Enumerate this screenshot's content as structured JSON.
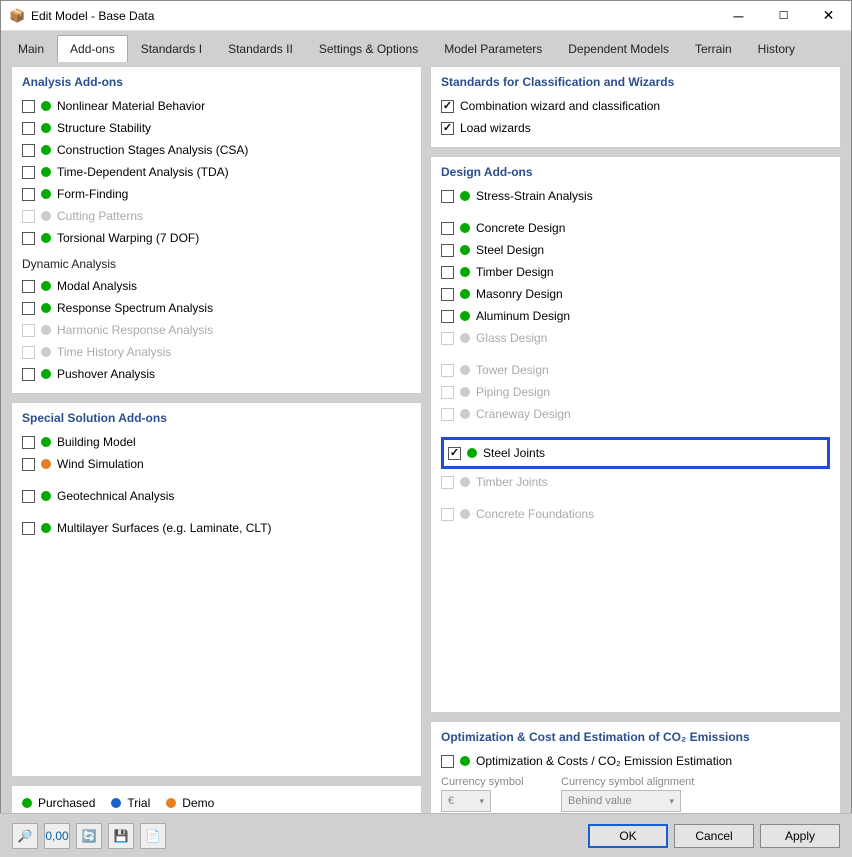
{
  "window": {
    "title": "Edit Model - Base Data",
    "icon": "📦"
  },
  "tabs": [
    "Main",
    "Add-ons",
    "Standards I",
    "Standards II",
    "Settings & Options",
    "Model Parameters",
    "Dependent Models",
    "Terrain",
    "History"
  ],
  "activeTab": 1,
  "left": {
    "analysis": {
      "title": "Analysis Add-ons",
      "items": [
        {
          "label": "Nonlinear Material Behavior",
          "dot": "green",
          "checked": false,
          "enabled": true
        },
        {
          "label": "Structure Stability",
          "dot": "green",
          "checked": false,
          "enabled": true
        },
        {
          "label": "Construction Stages Analysis (CSA)",
          "dot": "green",
          "checked": false,
          "enabled": true
        },
        {
          "label": "Time-Dependent Analysis (TDA)",
          "dot": "green",
          "checked": false,
          "enabled": true
        },
        {
          "label": "Form-Finding",
          "dot": "green",
          "checked": false,
          "enabled": true
        },
        {
          "label": "Cutting Patterns",
          "dot": "grey",
          "checked": false,
          "enabled": false
        },
        {
          "label": "Torsional Warping (7 DOF)",
          "dot": "green",
          "checked": false,
          "enabled": true
        }
      ],
      "dynTitle": "Dynamic Analysis",
      "dyn": [
        {
          "label": "Modal Analysis",
          "dot": "green",
          "checked": false,
          "enabled": true
        },
        {
          "label": "Response Spectrum Analysis",
          "dot": "green",
          "checked": false,
          "enabled": true
        },
        {
          "label": "Harmonic Response Analysis",
          "dot": "grey",
          "checked": false,
          "enabled": false
        },
        {
          "label": "Time History Analysis",
          "dot": "grey",
          "checked": false,
          "enabled": false
        },
        {
          "label": "Pushover Analysis",
          "dot": "green",
          "checked": false,
          "enabled": true
        }
      ]
    },
    "special": {
      "title": "Special Solution Add-ons",
      "items": [
        {
          "label": "Building Model",
          "dot": "green",
          "checked": false,
          "enabled": true
        },
        {
          "label": "Wind Simulation",
          "dot": "orange",
          "checked": false,
          "enabled": true
        },
        {
          "label": "Geotechnical Analysis",
          "dot": "green",
          "checked": false,
          "enabled": true
        },
        {
          "label": "Multilayer Surfaces (e.g. Laminate, CLT)",
          "dot": "green",
          "checked": false,
          "enabled": true
        }
      ]
    }
  },
  "right": {
    "standards": {
      "title": "Standards for Classification and Wizards",
      "items": [
        {
          "label": "Combination wizard and classification",
          "checked": true
        },
        {
          "label": "Load wizards",
          "checked": true
        }
      ]
    },
    "design": {
      "title": "Design Add-ons",
      "g1": [
        {
          "label": "Stress-Strain Analysis",
          "dot": "green",
          "checked": false,
          "enabled": true
        }
      ],
      "g2": [
        {
          "label": "Concrete Design",
          "dot": "green",
          "checked": false,
          "enabled": true
        },
        {
          "label": "Steel Design",
          "dot": "green",
          "checked": false,
          "enabled": true
        },
        {
          "label": "Timber Design",
          "dot": "green",
          "checked": false,
          "enabled": true
        },
        {
          "label": "Masonry Design",
          "dot": "green",
          "checked": false,
          "enabled": true
        },
        {
          "label": "Aluminum Design",
          "dot": "green",
          "checked": false,
          "enabled": true
        },
        {
          "label": "Glass Design",
          "dot": "grey",
          "checked": false,
          "enabled": false
        }
      ],
      "g3": [
        {
          "label": "Tower Design",
          "dot": "grey",
          "checked": false,
          "enabled": false
        },
        {
          "label": "Piping Design",
          "dot": "grey",
          "checked": false,
          "enabled": false
        },
        {
          "label": "Craneway Design",
          "dot": "grey",
          "checked": false,
          "enabled": false
        }
      ],
      "g4": [
        {
          "label": "Steel Joints",
          "dot": "green",
          "checked": true,
          "enabled": true,
          "highlight": true
        },
        {
          "label": "Timber Joints",
          "dot": "grey",
          "checked": false,
          "enabled": false
        }
      ],
      "g5": [
        {
          "label": "Concrete Foundations",
          "dot": "grey",
          "checked": false,
          "enabled": false
        }
      ]
    },
    "opt": {
      "title": "Optimization & Cost and Estimation of CO₂ Emissions",
      "items": [
        {
          "label": "Optimization & Costs / CO₂ Emission Estimation",
          "dot": "green",
          "checked": false,
          "enabled": true
        }
      ],
      "currLabel": "Currency symbol",
      "currVal": "€",
      "alignLabel": "Currency symbol alignment",
      "alignVal": "Behind value"
    }
  },
  "legend": {
    "purchased": "Purchased",
    "trial": "Trial",
    "demo": "Demo"
  },
  "footer": {
    "ok": "OK",
    "cancel": "Cancel",
    "apply": "Apply"
  }
}
